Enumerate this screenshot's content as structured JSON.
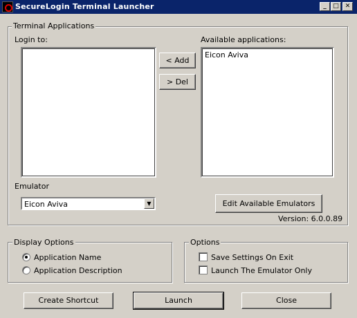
{
  "window": {
    "title": "SecureLogin Terminal Launcher",
    "minimize_glyph": "_",
    "maximize_glyph": "□",
    "close_glyph": "✕"
  },
  "terminal_applications": {
    "group_label": "Terminal Applications",
    "login_to_label": "Login to:",
    "login_to_items": [],
    "available_label": "Available applications:",
    "available_items": [
      "Eicon Aviva"
    ],
    "add_button": "< Add",
    "del_button": "> Del",
    "emulator_label": "Emulator",
    "emulator_value": "Eicon Aviva",
    "edit_emulators_button": "Edit Available Emulators",
    "version_text": "Version: 6.0.0.89"
  },
  "display_options": {
    "group_label": "Display Options",
    "options": [
      {
        "label": "Application Name",
        "checked": true
      },
      {
        "label": "Application Description",
        "checked": false
      }
    ]
  },
  "options": {
    "group_label": "Options",
    "checkboxes": [
      {
        "label": "Save Settings On Exit",
        "checked": false
      },
      {
        "label": "Launch The Emulator Only",
        "checked": false
      }
    ]
  },
  "footer": {
    "create_shortcut_button": "Create Shortcut",
    "launch_button": "Launch",
    "close_button": "Close"
  }
}
